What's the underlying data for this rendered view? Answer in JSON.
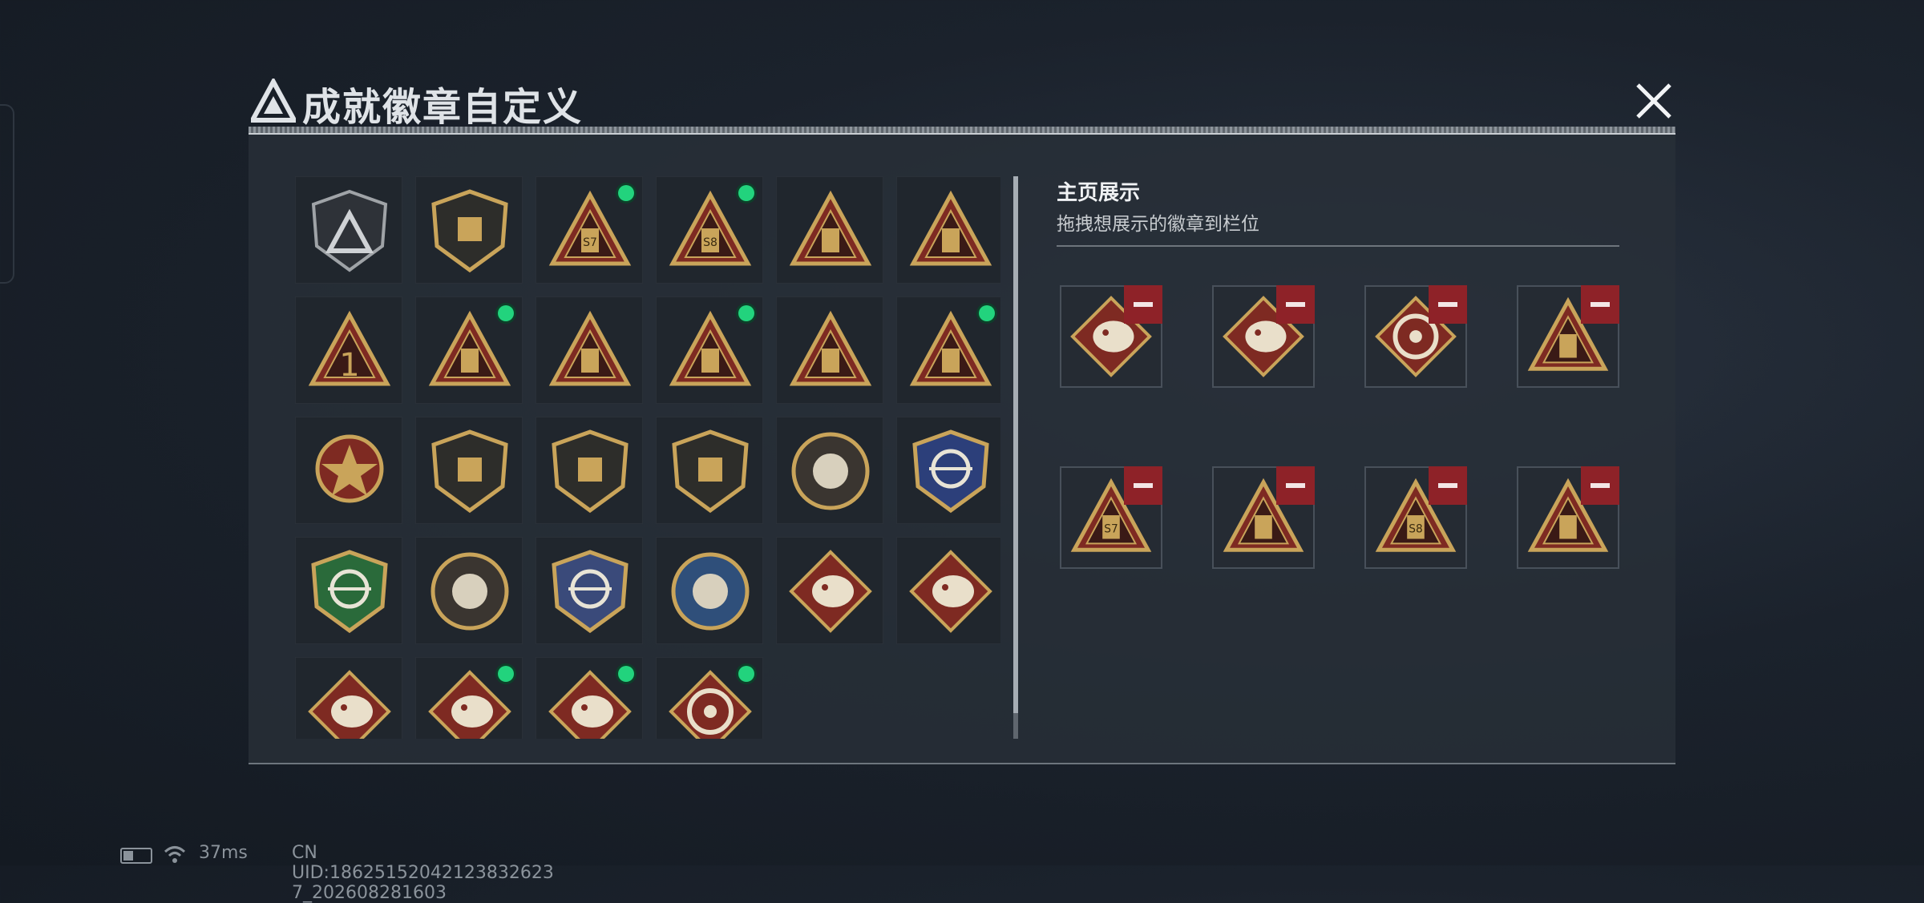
{
  "title": "成就徽章自定义",
  "showcase": {
    "title": "主页展示",
    "subtitle": "拖拽想展示的徽章到栏位"
  },
  "badges": [
    {
      "icon": "silver-shield-triangle-badge",
      "new": false
    },
    {
      "icon": "helicopter-shield-badge",
      "new": false
    },
    {
      "icon": "s7-tower-triangle-badge",
      "new": true
    },
    {
      "icon": "s8-tower-triangle-badge",
      "new": true
    },
    {
      "icon": "skull-swords-triangle-badge",
      "new": false
    },
    {
      "icon": "ship-triangle-badge",
      "new": false
    },
    {
      "icon": "number-one-triangle-badge",
      "new": false
    },
    {
      "icon": "crate-triangle-badge",
      "new": true
    },
    {
      "icon": "soldier-triangle-badge",
      "new": false
    },
    {
      "icon": "dice-hands-triangle-badge",
      "new": true
    },
    {
      "icon": "squad-triangle-badge",
      "new": false
    },
    {
      "icon": "rocket-triangle-badge",
      "new": true
    },
    {
      "icon": "star-medal-badge",
      "new": false
    },
    {
      "icon": "emblem-shield-badge",
      "new": false
    },
    {
      "icon": "star-crest-badge",
      "new": false
    },
    {
      "icon": "dice-shield-badge",
      "new": false
    },
    {
      "icon": "round-crest-badge",
      "new": false
    },
    {
      "icon": "blue-crosshair-shield-badge",
      "new": false
    },
    {
      "icon": "green-crosshair-shield-badge",
      "new": false
    },
    {
      "icon": "rifle-round-shield-badge",
      "new": false
    },
    {
      "icon": "gold-crosshair-shield-badge",
      "new": false
    },
    {
      "icon": "eagle-coin-badge",
      "new": false
    },
    {
      "icon": "dragon-diamond-badge",
      "new": false
    },
    {
      "icon": "dragon-diamond-badge-2",
      "new": false
    },
    {
      "icon": "runner-diamond-badge",
      "new": false
    },
    {
      "icon": "serpent-diamond-badge",
      "new": true
    },
    {
      "icon": "serpent-diamond-badge-2",
      "new": true
    },
    {
      "icon": "wheel-diamond-badge",
      "new": true
    }
  ],
  "slots": [
    {
      "icon": "serpent-diamond-badge"
    },
    {
      "icon": "serpent-diamond-badge-2"
    },
    {
      "icon": "wheel-diamond-badge"
    },
    {
      "icon": "dice-hands-triangle-badge"
    },
    {
      "icon": "s7-tower-triangle-badge"
    },
    {
      "icon": "crate-triangle-badge"
    },
    {
      "icon": "s8-tower-triangle-badge"
    },
    {
      "icon": "rocket-triangle-badge"
    }
  ],
  "status": {
    "ping": "37ms",
    "uid": "CN UID:18625152042123832623 7_202608281603"
  },
  "colors": {
    "gold": "#c9a45a",
    "red": "#7e2a22",
    "new_dot": "#22d37d",
    "remove": "#8e2228"
  }
}
